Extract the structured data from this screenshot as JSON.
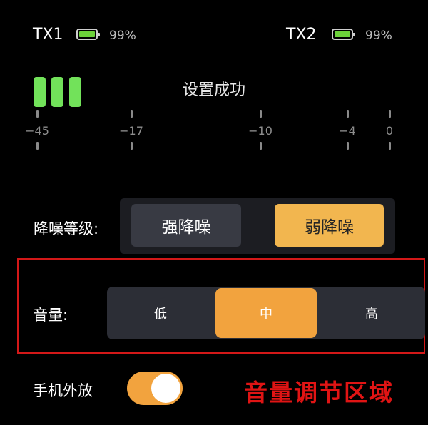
{
  "status_bar": {
    "tx1": {
      "label": "TX1",
      "battery_percent": "99%",
      "battery_level": 0.99,
      "battery_color": "#6cd13a"
    },
    "tx2": {
      "label": "TX2",
      "battery_percent": "99%",
      "battery_level": 0.99,
      "battery_color": "#6cd13a"
    }
  },
  "meter": {
    "active_bars": 3,
    "bar_color": "#72e25a",
    "status_text": "设置成功",
    "scale_labels": [
      "−45",
      "−17",
      "−10",
      "−4",
      "0"
    ]
  },
  "noise_reduction": {
    "label": "降噪等级:",
    "options": [
      "强降噪",
      "弱降噪"
    ],
    "selected": "弱降噪"
  },
  "volume": {
    "label": "音量:",
    "options": [
      "低",
      "中",
      "高"
    ],
    "selected": "中"
  },
  "speaker": {
    "label": "手机外放",
    "enabled": true
  },
  "annotation": {
    "text": "音量调节区域",
    "color": "#e01414"
  },
  "accent_color": "#f2a33e"
}
